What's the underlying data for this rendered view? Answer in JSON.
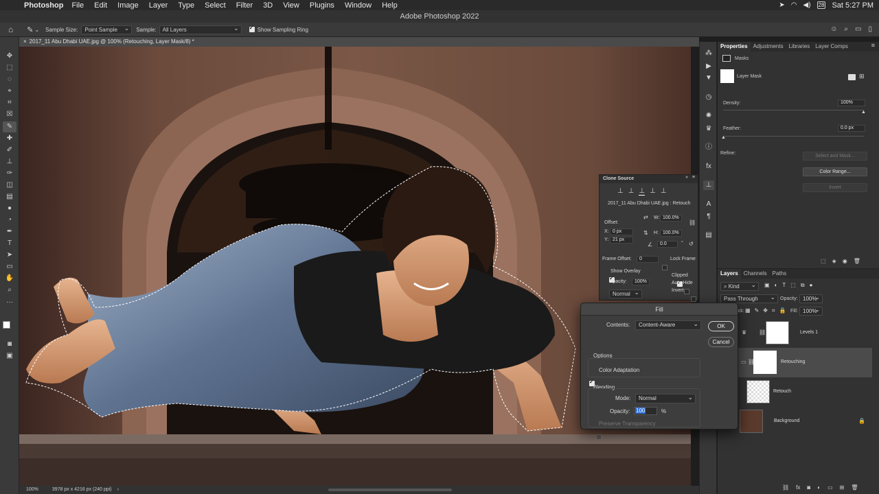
{
  "menubar": {
    "app": "Photoshop",
    "items": [
      "File",
      "Edit",
      "Image",
      "Layer",
      "Type",
      "Select",
      "Filter",
      "3D",
      "View",
      "Plugins",
      "Window",
      "Help"
    ],
    "clock": "Sat 5:27 PM",
    "date_badge": "28"
  },
  "window_title": "Adobe Photoshop 2022",
  "options_bar": {
    "sample_size_label": "Sample Size:",
    "sample_size_value": "Point Sample",
    "sample_label": "Sample:",
    "sample_value": "All Layers",
    "show_ring_label": "Show Sampling Ring"
  },
  "document_tab": "2017_11 Abu Dhabi UAE.jpg @ 100% (Retouching, Layer Mask/8) *",
  "status_bar": {
    "zoom": "100%",
    "doc_info": "3978 px x 4216 px (240 ppi)"
  },
  "properties": {
    "tabs": [
      "Properties",
      "Adjustments",
      "Libraries",
      "Layer Comps"
    ],
    "section": "Masks",
    "mask_name": "Layer Mask",
    "density_label": "Density:",
    "density_value": "100%",
    "feather_label": "Feather:",
    "feather_value": "0.0 px",
    "refine_label": "Refine:",
    "select_mask": "Select and Mask...",
    "color_range": "Color Range...",
    "invert": "Invert"
  },
  "clone_source": {
    "title": "Clone Source",
    "file": "2017_11 Abu Dhabi UAE.jpg : Retouch",
    "offset_label": "Offset:",
    "x_label": "X:",
    "x_value": "0 px",
    "y_label": "Y:",
    "y_value": "21 px",
    "w_label": "W:",
    "w_value": "100.0%",
    "h_label": "H:",
    "h_value": "100.0%",
    "angle_value": "0.0",
    "angle_unit": "°",
    "frame_offset_label": "Frame Offset:",
    "frame_offset_value": "0",
    "lock_frame": "Lock Frame",
    "show_overlay": "Show Overlay",
    "opacity_label": "Opacity:",
    "opacity_value": "100%",
    "blend_mode": "Normal",
    "clipped": "Clipped",
    "auto_hide": "Auto Hide",
    "invert": "Invert"
  },
  "fill_dialog": {
    "title": "Fill",
    "contents_label": "Contents:",
    "contents_value": "Content-Aware",
    "ok": "OK",
    "cancel": "Cancel",
    "options_label": "Options",
    "color_adaptation": "Color Adaptation",
    "blending_label": "Blending",
    "mode_label": "Mode:",
    "mode_value": "Normal",
    "opacity_label": "Opacity:",
    "opacity_value": "100",
    "opacity_unit": "%",
    "preserve_transparency": "Preserve Transparency"
  },
  "layers_panel": {
    "tabs": [
      "Layers",
      "Channels",
      "Paths"
    ],
    "filter_kind": "Kind",
    "blend_mode": "Pass Through",
    "opacity_label": "Opacity:",
    "opacity_value": "100%",
    "lock_label": "Lock:",
    "fill_label": "Fill:",
    "fill_value": "100%",
    "layers": [
      {
        "name": "Levels 1"
      },
      {
        "name": "Retouching"
      },
      {
        "name": "Retouch"
      },
      {
        "name": "Background"
      }
    ]
  },
  "colors": {
    "accent_blue": "#2f6fd6",
    "selected_row": "#4b4b4b"
  }
}
